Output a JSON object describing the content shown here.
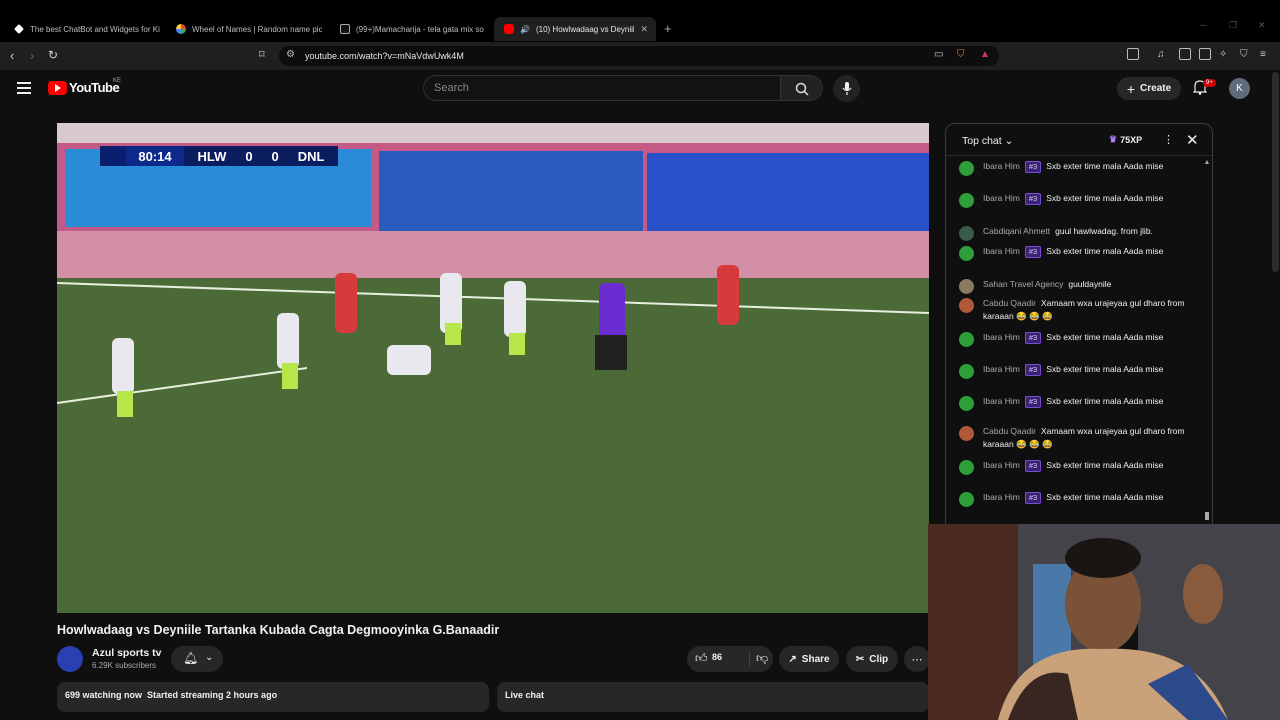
{
  "browser": {
    "tabs": [
      {
        "title": "The best ChatBot and Widgets for Ki",
        "active": false
      },
      {
        "title": "Wheel of Names | Random name pic",
        "active": false
      },
      {
        "title": "(99+)Mamacharija - tela gata mix so",
        "active": false
      },
      {
        "title": "(10) Howlwadaag vs Deyniile",
        "active": true
      }
    ],
    "url": "youtube.com/watch?v=mNaVdwUwk4M"
  },
  "youtube": {
    "logo_text": "YouTube",
    "country_code": "KE",
    "search_placeholder": "Search",
    "create_label": "Create",
    "notifications_badge": "9+",
    "avatar_letter": "K"
  },
  "video": {
    "scoreboard": {
      "time": "80:14",
      "home": "HLW",
      "home_score": "0",
      "away_score": "0",
      "away": "DNL"
    },
    "title": "Howlwadaag vs Deyniile Tartanka Kubada Cagta Degmooyinka G.Banaadir",
    "channel_name": "Azul sports tv",
    "subscribers": "6.29K subscribers",
    "likes": "86",
    "share_label": "Share",
    "clip_label": "Clip",
    "watching": "699 watching now",
    "started": "Started streaming 2 hours ago",
    "live_chat_label": "Live chat"
  },
  "chat": {
    "header": "Top chat",
    "xp": "75XP",
    "messages": [
      {
        "author": "Ibara Him",
        "tag": "#3",
        "text": "Sxb exter time mala Aada mise",
        "avatar": "#2e9e3a"
      },
      {
        "author": "Ibara Him",
        "tag": "#3",
        "text": "Sxb exter time mala Aada mise",
        "avatar": "#2e9e3a"
      },
      {
        "author": "Cabdiqani Ahmett",
        "tag": "",
        "text": "guul hawlwadag. from jlib.",
        "avatar": "#3a5a4a"
      },
      {
        "author": "Ibara Him",
        "tag": "#3",
        "text": "Sxb exter time mala Aada mise",
        "avatar": "#2e9e3a"
      },
      {
        "author": "Sahan Travel Agency",
        "tag": "",
        "text": "guuldaynile",
        "avatar": "#8a7a60"
      },
      {
        "author": "Cabdu Qaadir",
        "tag": "",
        "text": "Xamaam wxa urajeyaa gul dharo from karaaan 😂 😂 😂",
        "avatar": "#b0583a"
      },
      {
        "author": "Ibara Him",
        "tag": "#3",
        "text": "Sxb exter time mala Aada mise",
        "avatar": "#2e9e3a"
      },
      {
        "author": "Ibara Him",
        "tag": "#3",
        "text": "Sxb exter time mala Aada mise",
        "avatar": "#2e9e3a"
      },
      {
        "author": "Ibara Him",
        "tag": "#3",
        "text": "Sxb exter time mala Aada mise",
        "avatar": "#2e9e3a"
      },
      {
        "author": "Cabdu Qaadir",
        "tag": "",
        "text": "Xamaam wxa urajeyaa gul dharo from karaaan 😂 😂 😂",
        "avatar": "#b0583a"
      },
      {
        "author": "Ibara Him",
        "tag": "#3",
        "text": "Sxb exter time mala Aada mise",
        "avatar": "#2e9e3a"
      },
      {
        "author": "Ibara Him",
        "tag": "#3",
        "text": "Sxb exter time mala Aada mise",
        "avatar": "#2e9e3a"
      }
    ]
  },
  "colors": {
    "accent_red": "#ff0000",
    "member_purple": "#7b4dd6"
  }
}
